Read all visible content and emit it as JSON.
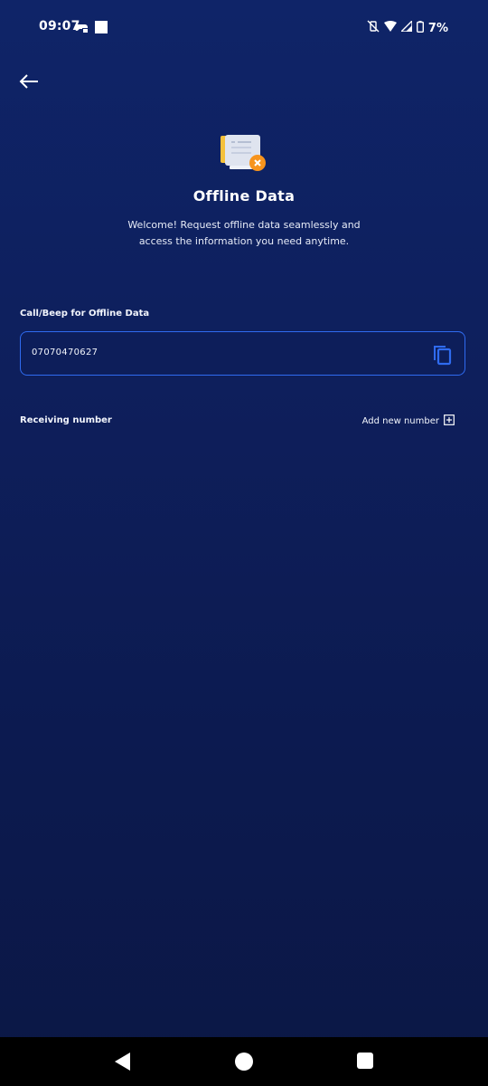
{
  "status_bar": {
    "time": "09:07",
    "battery": "7%"
  },
  "header": {
    "title": "Offline Data",
    "subtitle_line1": "Welcome! Request offline data seamlessly and",
    "subtitle_line2": "access the information you need anytime."
  },
  "call_section": {
    "label": "Call/Beep for Offline Data",
    "number": "07070470627"
  },
  "receiving_section": {
    "label": "Receiving number",
    "add_label": "Add new number"
  },
  "colors": {
    "background_top": "#0f2468",
    "background_bottom": "#0b1745",
    "accent": "#2f6bf0",
    "icon_badge": "#f7941d"
  },
  "icons": [
    "back-arrow-icon",
    "document-icon",
    "copy-icon",
    "add-box-icon"
  ]
}
